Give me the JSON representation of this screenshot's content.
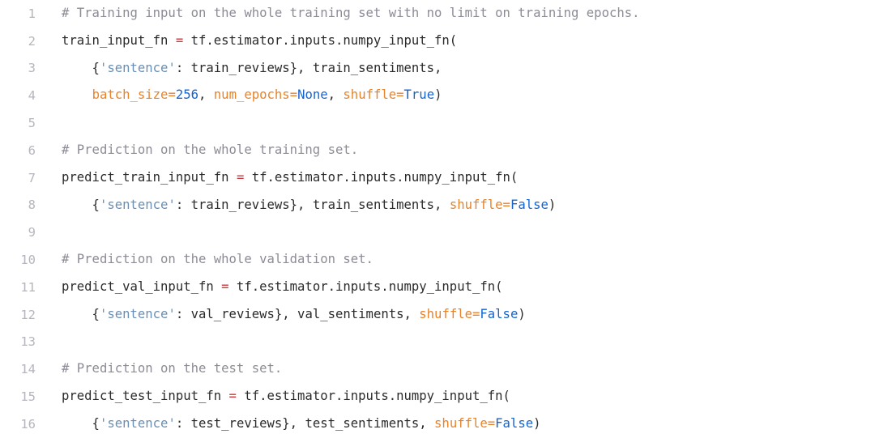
{
  "editor": {
    "background": "#ffffff",
    "language": "python",
    "gutter_color": "#b5b5bd",
    "total_lines": 16,
    "palette": {
      "plain": "#2b2b2b",
      "comment": "#8c8c96",
      "string": "#6a8fb5",
      "kwarg": "#e8832a",
      "literal": "#1464d0",
      "assign": "#d13438",
      "operator": "#e8832a"
    }
  },
  "lines": [
    {
      "number": "1",
      "tokens": [
        {
          "t": "# Training input on the whole training set with no limit on training epochs.",
          "c": "comment"
        }
      ]
    },
    {
      "number": "2",
      "tokens": [
        {
          "t": "train_input_fn ",
          "c": "plain"
        },
        {
          "t": "=",
          "c": "assign"
        },
        {
          "t": " tf.estimator.inputs.numpy_input_fn(",
          "c": "plain"
        }
      ]
    },
    {
      "number": "3",
      "tokens": [
        {
          "t": "    {",
          "c": "plain"
        },
        {
          "t": "'sentence'",
          "c": "string"
        },
        {
          "t": ": train_reviews}, train_sentiments,",
          "c": "plain"
        }
      ]
    },
    {
      "number": "4",
      "tokens": [
        {
          "t": "    ",
          "c": "plain"
        },
        {
          "t": "batch_size",
          "c": "kwarg"
        },
        {
          "t": "=",
          "c": "operator"
        },
        {
          "t": "256",
          "c": "literal"
        },
        {
          "t": ", ",
          "c": "plain"
        },
        {
          "t": "num_epochs",
          "c": "kwarg"
        },
        {
          "t": "=",
          "c": "operator"
        },
        {
          "t": "None",
          "c": "literal"
        },
        {
          "t": ", ",
          "c": "plain"
        },
        {
          "t": "shuffle",
          "c": "kwarg"
        },
        {
          "t": "=",
          "c": "operator"
        },
        {
          "t": "True",
          "c": "literal"
        },
        {
          "t": ")",
          "c": "plain"
        }
      ]
    },
    {
      "number": "5",
      "tokens": []
    },
    {
      "number": "6",
      "tokens": [
        {
          "t": "# Prediction on the whole training set.",
          "c": "comment"
        }
      ]
    },
    {
      "number": "7",
      "tokens": [
        {
          "t": "predict_train_input_fn ",
          "c": "plain"
        },
        {
          "t": "=",
          "c": "assign"
        },
        {
          "t": " tf.estimator.inputs.numpy_input_fn(",
          "c": "plain"
        }
      ]
    },
    {
      "number": "8",
      "tokens": [
        {
          "t": "    {",
          "c": "plain"
        },
        {
          "t": "'sentence'",
          "c": "string"
        },
        {
          "t": ": train_reviews}, train_sentiments, ",
          "c": "plain"
        },
        {
          "t": "shuffle",
          "c": "kwarg"
        },
        {
          "t": "=",
          "c": "operator"
        },
        {
          "t": "False",
          "c": "literal"
        },
        {
          "t": ")",
          "c": "plain"
        }
      ]
    },
    {
      "number": "9",
      "tokens": []
    },
    {
      "number": "10",
      "tokens": [
        {
          "t": "# Prediction on the whole validation set.",
          "c": "comment"
        }
      ]
    },
    {
      "number": "11",
      "tokens": [
        {
          "t": "predict_val_input_fn ",
          "c": "plain"
        },
        {
          "t": "=",
          "c": "assign"
        },
        {
          "t": " tf.estimator.inputs.numpy_input_fn(",
          "c": "plain"
        }
      ]
    },
    {
      "number": "12",
      "tokens": [
        {
          "t": "    {",
          "c": "plain"
        },
        {
          "t": "'sentence'",
          "c": "string"
        },
        {
          "t": ": val_reviews}, val_sentiments, ",
          "c": "plain"
        },
        {
          "t": "shuffle",
          "c": "kwarg"
        },
        {
          "t": "=",
          "c": "operator"
        },
        {
          "t": "False",
          "c": "literal"
        },
        {
          "t": ")",
          "c": "plain"
        }
      ]
    },
    {
      "number": "13",
      "tokens": []
    },
    {
      "number": "14",
      "tokens": [
        {
          "t": "# Prediction on the test set.",
          "c": "comment"
        }
      ]
    },
    {
      "number": "15",
      "tokens": [
        {
          "t": "predict_test_input_fn ",
          "c": "plain"
        },
        {
          "t": "=",
          "c": "assign"
        },
        {
          "t": " tf.estimator.inputs.numpy_input_fn(",
          "c": "plain"
        }
      ]
    },
    {
      "number": "16",
      "tokens": [
        {
          "t": "    {",
          "c": "plain"
        },
        {
          "t": "'sentence'",
          "c": "string"
        },
        {
          "t": ": test_reviews}, test_sentiments, ",
          "c": "plain"
        },
        {
          "t": "shuffle",
          "c": "kwarg"
        },
        {
          "t": "=",
          "c": "operator"
        },
        {
          "t": "False",
          "c": "literal"
        },
        {
          "t": ")",
          "c": "plain"
        }
      ]
    }
  ]
}
